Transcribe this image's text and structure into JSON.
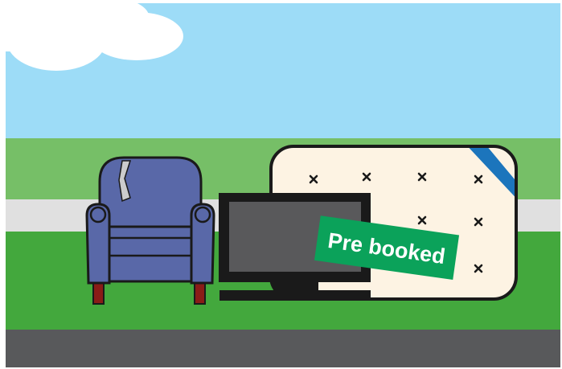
{
  "illustration": {
    "sign": {
      "label": "Pre booked",
      "color": "#0ba25a"
    },
    "objects": [
      "cloud",
      "armchair",
      "television",
      "mattress"
    ],
    "colors": {
      "sky": "#9ddcf7",
      "far_grass": "#76bf67",
      "path": "#e0e0e0",
      "near_grass": "#43a83d",
      "road": "#58595b",
      "chair": "#5968a8",
      "chair_legs": "#8a1c17",
      "tv_screen": "#59595b",
      "mattress": "#fdf3e3",
      "mattress_ribbon": "#1c75bc"
    }
  }
}
